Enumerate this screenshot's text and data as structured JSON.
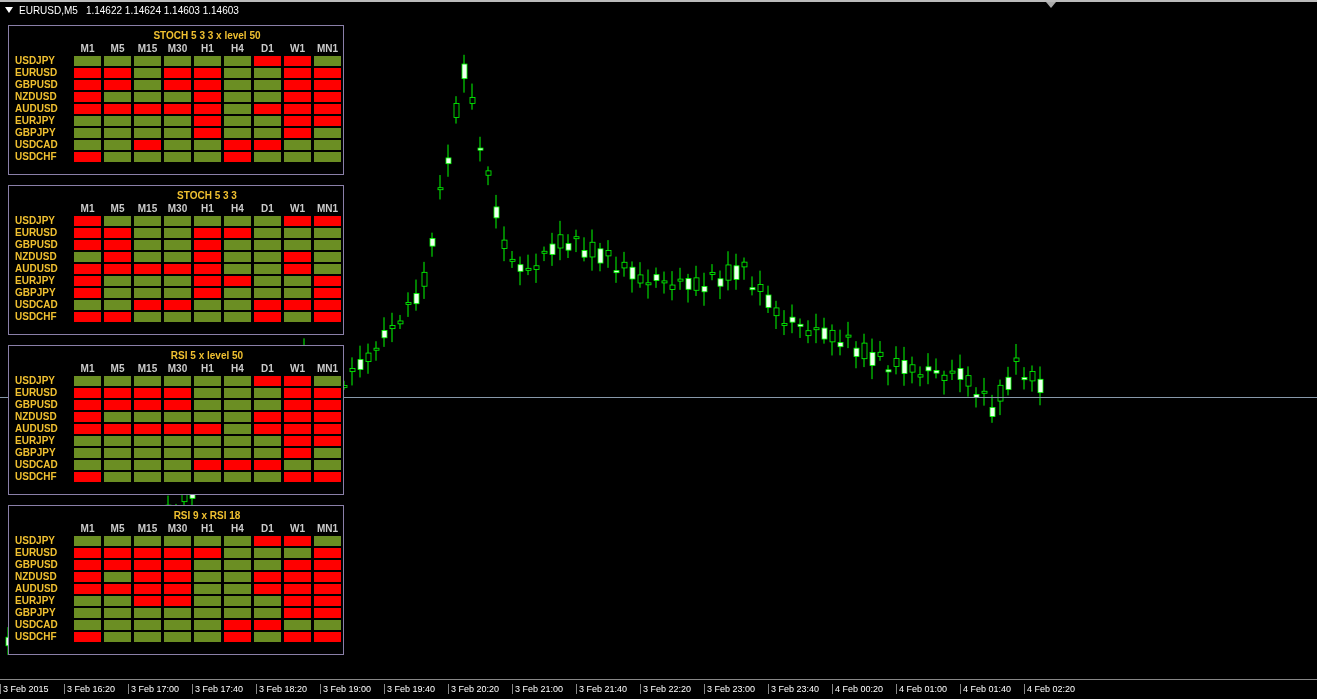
{
  "chart_header": {
    "symbol": "EURUSD,M5",
    "prices": "1.14622 1.14624 1.14603 1.14603"
  },
  "panels": [
    {
      "title": "STOCH 5 3 3 x level 50",
      "columns": [
        "M1",
        "M5",
        "M15",
        "M30",
        "H1",
        "H4",
        "D1",
        "W1",
        "MN1"
      ],
      "rows": [
        {
          "pair": "USDJPY",
          "cells": [
            {
              "color": "#6b8e23"
            },
            {
              "color": "#6b8e23"
            },
            {
              "color": "#6b8e23"
            },
            {
              "color": "#6b8e23"
            },
            {
              "color": "#6b8e23"
            },
            {
              "color": "#6b8e23"
            },
            {
              "color": "#ff0000"
            },
            {
              "color": "#ff0000"
            },
            {
              "color": "#6b8e23"
            }
          ]
        },
        {
          "pair": "EURUSD",
          "cells": [
            {
              "color": "#ff0000"
            },
            {
              "color": "#ff0000"
            },
            {
              "color": "#6b8e23"
            },
            {
              "color": "#ff0000"
            },
            {
              "color": "#ff0000"
            },
            {
              "color": "#6b8e23"
            },
            {
              "color": "#6b8e23"
            },
            {
              "color": "#ff0000"
            },
            {
              "color": "#ff0000"
            }
          ]
        },
        {
          "pair": "GBPUSD",
          "cells": [
            {
              "color": "#ff0000"
            },
            {
              "color": "#ff0000"
            },
            {
              "color": "#6b8e23"
            },
            {
              "color": "#ff0000"
            },
            {
              "color": "#ff0000"
            },
            {
              "color": "#6b8e23"
            },
            {
              "color": "#6b8e23"
            },
            {
              "color": "#ff0000"
            },
            {
              "color": "#ff0000"
            }
          ]
        },
        {
          "pair": "NZDUSD",
          "cells": [
            {
              "color": "#ff0000"
            },
            {
              "color": "#6b8e23"
            },
            {
              "color": "#6b8e23"
            },
            {
              "color": "#6b8e23"
            },
            {
              "color": "#ff0000"
            },
            {
              "color": "#6b8e23"
            },
            {
              "color": "#6b8e23"
            },
            {
              "color": "#ff0000"
            },
            {
              "color": "#ff0000"
            }
          ]
        },
        {
          "pair": "AUDUSD",
          "cells": [
            {
              "color": "#ff0000"
            },
            {
              "color": "#ff0000"
            },
            {
              "color": "#ff0000"
            },
            {
              "color": "#ff0000"
            },
            {
              "color": "#ff0000"
            },
            {
              "color": "#6b8e23"
            },
            {
              "color": "#ff0000"
            },
            {
              "color": "#ff0000"
            },
            {
              "color": "#ff0000"
            }
          ]
        },
        {
          "pair": "EURJPY",
          "cells": [
            {
              "color": "#6b8e23"
            },
            {
              "color": "#6b8e23"
            },
            {
              "color": "#6b8e23"
            },
            {
              "color": "#6b8e23"
            },
            {
              "color": "#ff0000"
            },
            {
              "color": "#6b8e23"
            },
            {
              "color": "#6b8e23"
            },
            {
              "color": "#ff0000"
            },
            {
              "color": "#ff0000"
            }
          ]
        },
        {
          "pair": "GBPJPY",
          "cells": [
            {
              "color": "#6b8e23"
            },
            {
              "color": "#6b8e23"
            },
            {
              "color": "#6b8e23"
            },
            {
              "color": "#6b8e23"
            },
            {
              "color": "#ff0000"
            },
            {
              "color": "#6b8e23"
            },
            {
              "color": "#6b8e23"
            },
            {
              "color": "#ff0000"
            },
            {
              "color": "#6b8e23"
            }
          ]
        },
        {
          "pair": "USDCAD",
          "cells": [
            {
              "color": "#6b8e23"
            },
            {
              "color": "#6b8e23"
            },
            {
              "color": "#ff0000"
            },
            {
              "color": "#6b8e23"
            },
            {
              "color": "#6b8e23"
            },
            {
              "color": "#ff0000"
            },
            {
              "color": "#ff0000"
            },
            {
              "color": "#6b8e23"
            },
            {
              "color": "#6b8e23"
            }
          ]
        },
        {
          "pair": "USDCHF",
          "cells": [
            {
              "color": "#ff0000"
            },
            {
              "color": "#6b8e23"
            },
            {
              "color": "#6b8e23"
            },
            {
              "color": "#6b8e23"
            },
            {
              "color": "#6b8e23"
            },
            {
              "color": "#ff0000"
            },
            {
              "color": "#6b8e23"
            },
            {
              "color": "#6b8e23"
            },
            {
              "color": "#6b8e23"
            }
          ]
        }
      ]
    },
    {
      "title": "STOCH 5 3 3",
      "columns": [
        "M1",
        "M5",
        "M15",
        "M30",
        "H1",
        "H4",
        "D1",
        "W1",
        "MN1"
      ],
      "rows": [
        {
          "pair": "USDJPY",
          "cells": [
            {
              "color": "#ff0000"
            },
            {
              "color": "#6b8e23"
            },
            {
              "color": "#6b8e23"
            },
            {
              "color": "#6b8e23"
            },
            {
              "color": "#6b8e23"
            },
            {
              "color": "#6b8e23"
            },
            {
              "color": "#6b8e23"
            },
            {
              "color": "#ff0000"
            },
            {
              "color": "#ff0000"
            }
          ]
        },
        {
          "pair": "EURUSD",
          "cells": [
            {
              "color": "#ff0000"
            },
            {
              "color": "#ff0000"
            },
            {
              "color": "#6b8e23"
            },
            {
              "color": "#6b8e23"
            },
            {
              "color": "#ff0000"
            },
            {
              "color": "#ff0000"
            },
            {
              "color": "#6b8e23"
            },
            {
              "color": "#6b8e23"
            },
            {
              "color": "#6b8e23"
            }
          ]
        },
        {
          "pair": "GBPUSD",
          "cells": [
            {
              "color": "#ff0000"
            },
            {
              "color": "#ff0000"
            },
            {
              "color": "#6b8e23"
            },
            {
              "color": "#6b8e23"
            },
            {
              "color": "#ff0000"
            },
            {
              "color": "#6b8e23"
            },
            {
              "color": "#6b8e23"
            },
            {
              "color": "#6b8e23"
            },
            {
              "color": "#6b8e23"
            }
          ]
        },
        {
          "pair": "NZDUSD",
          "cells": [
            {
              "color": "#6b8e23"
            },
            {
              "color": "#ff0000"
            },
            {
              "color": "#6b8e23"
            },
            {
              "color": "#6b8e23"
            },
            {
              "color": "#ff0000"
            },
            {
              "color": "#6b8e23"
            },
            {
              "color": "#6b8e23"
            },
            {
              "color": "#ff0000"
            },
            {
              "color": "#6b8e23"
            }
          ]
        },
        {
          "pair": "AUDUSD",
          "cells": [
            {
              "color": "#ff0000"
            },
            {
              "color": "#ff0000"
            },
            {
              "color": "#ff0000"
            },
            {
              "color": "#ff0000"
            },
            {
              "color": "#ff0000"
            },
            {
              "color": "#6b8e23"
            },
            {
              "color": "#6b8e23"
            },
            {
              "color": "#ff0000"
            },
            {
              "color": "#6b8e23"
            }
          ]
        },
        {
          "pair": "EURJPY",
          "cells": [
            {
              "color": "#ff0000"
            },
            {
              "color": "#6b8e23"
            },
            {
              "color": "#6b8e23"
            },
            {
              "color": "#6b8e23"
            },
            {
              "color": "#ff0000"
            },
            {
              "color": "#ff0000"
            },
            {
              "color": "#6b8e23"
            },
            {
              "color": "#6b8e23"
            },
            {
              "color": "#ff0000"
            }
          ]
        },
        {
          "pair": "GBPJPY",
          "cells": [
            {
              "color": "#ff0000"
            },
            {
              "color": "#6b8e23"
            },
            {
              "color": "#6b8e23"
            },
            {
              "color": "#6b8e23"
            },
            {
              "color": "#ff0000"
            },
            {
              "color": "#6b8e23"
            },
            {
              "color": "#6b8e23"
            },
            {
              "color": "#6b8e23"
            },
            {
              "color": "#ff0000"
            }
          ]
        },
        {
          "pair": "USDCAD",
          "cells": [
            {
              "color": "#6b8e23"
            },
            {
              "color": "#6b8e23"
            },
            {
              "color": "#ff0000"
            },
            {
              "color": "#ff0000"
            },
            {
              "color": "#6b8e23"
            },
            {
              "color": "#6b8e23"
            },
            {
              "color": "#ff0000"
            },
            {
              "color": "#ff0000"
            },
            {
              "color": "#ff0000"
            }
          ]
        },
        {
          "pair": "USDCHF",
          "cells": [
            {
              "color": "#ff0000"
            },
            {
              "color": "#ff0000"
            },
            {
              "color": "#6b8e23"
            },
            {
              "color": "#6b8e23"
            },
            {
              "color": "#6b8e23"
            },
            {
              "color": "#6b8e23"
            },
            {
              "color": "#ff0000"
            },
            {
              "color": "#6b8e23"
            },
            {
              "color": "#ff0000"
            }
          ]
        }
      ]
    },
    {
      "title": "RSI 5 x level 50",
      "columns": [
        "M1",
        "M5",
        "M15",
        "M30",
        "H1",
        "H4",
        "D1",
        "W1",
        "MN1"
      ],
      "rows": [
        {
          "pair": "USDJPY",
          "cells": [
            {
              "color": "#6b8e23"
            },
            {
              "color": "#6b8e23"
            },
            {
              "color": "#6b8e23"
            },
            {
              "color": "#6b8e23"
            },
            {
              "color": "#6b8e23"
            },
            {
              "color": "#6b8e23"
            },
            {
              "color": "#ff0000"
            },
            {
              "color": "#ff0000"
            },
            {
              "color": "#6b8e23"
            }
          ]
        },
        {
          "pair": "EURUSD",
          "cells": [
            {
              "color": "#ff0000"
            },
            {
              "color": "#ff0000"
            },
            {
              "color": "#ff0000"
            },
            {
              "color": "#ff0000"
            },
            {
              "color": "#6b8e23"
            },
            {
              "color": "#6b8e23"
            },
            {
              "color": "#6b8e23"
            },
            {
              "color": "#ff0000"
            },
            {
              "color": "#ff0000"
            }
          ]
        },
        {
          "pair": "GBPUSD",
          "cells": [
            {
              "color": "#ff0000"
            },
            {
              "color": "#ff0000"
            },
            {
              "color": "#ff0000"
            },
            {
              "color": "#ff0000"
            },
            {
              "color": "#6b8e23"
            },
            {
              "color": "#6b8e23"
            },
            {
              "color": "#6b8e23"
            },
            {
              "color": "#ff0000"
            },
            {
              "color": "#ff0000"
            }
          ]
        },
        {
          "pair": "NZDUSD",
          "cells": [
            {
              "color": "#ff0000"
            },
            {
              "color": "#6b8e23"
            },
            {
              "color": "#6b8e23"
            },
            {
              "color": "#6b8e23"
            },
            {
              "color": "#6b8e23"
            },
            {
              "color": "#6b8e23"
            },
            {
              "color": "#ff0000"
            },
            {
              "color": "#ff0000"
            },
            {
              "color": "#ff0000"
            }
          ]
        },
        {
          "pair": "AUDUSD",
          "cells": [
            {
              "color": "#ff0000"
            },
            {
              "color": "#ff0000"
            },
            {
              "color": "#ff0000"
            },
            {
              "color": "#ff0000"
            },
            {
              "color": "#ff0000"
            },
            {
              "color": "#6b8e23"
            },
            {
              "color": "#ff0000"
            },
            {
              "color": "#ff0000"
            },
            {
              "color": "#ff0000"
            }
          ]
        },
        {
          "pair": "EURJPY",
          "cells": [
            {
              "color": "#6b8e23"
            },
            {
              "color": "#6b8e23"
            },
            {
              "color": "#6b8e23"
            },
            {
              "color": "#6b8e23"
            },
            {
              "color": "#6b8e23"
            },
            {
              "color": "#6b8e23"
            },
            {
              "color": "#6b8e23"
            },
            {
              "color": "#ff0000"
            },
            {
              "color": "#ff0000"
            }
          ]
        },
        {
          "pair": "GBPJPY",
          "cells": [
            {
              "color": "#6b8e23"
            },
            {
              "color": "#6b8e23"
            },
            {
              "color": "#6b8e23"
            },
            {
              "color": "#6b8e23"
            },
            {
              "color": "#6b8e23"
            },
            {
              "color": "#6b8e23"
            },
            {
              "color": "#6b8e23"
            },
            {
              "color": "#ff0000"
            },
            {
              "color": "#6b8e23"
            }
          ]
        },
        {
          "pair": "USDCAD",
          "cells": [
            {
              "color": "#6b8e23"
            },
            {
              "color": "#6b8e23"
            },
            {
              "color": "#6b8e23"
            },
            {
              "color": "#6b8e23"
            },
            {
              "color": "#ff0000"
            },
            {
              "color": "#ff0000"
            },
            {
              "color": "#ff0000"
            },
            {
              "color": "#6b8e23"
            },
            {
              "color": "#6b8e23"
            }
          ]
        },
        {
          "pair": "USDCHF",
          "cells": [
            {
              "color": "#ff0000"
            },
            {
              "color": "#6b8e23"
            },
            {
              "color": "#6b8e23"
            },
            {
              "color": "#6b8e23"
            },
            {
              "color": "#6b8e23"
            },
            {
              "color": "#6b8e23"
            },
            {
              "color": "#6b8e23"
            },
            {
              "color": "#ff0000"
            },
            {
              "color": "#ff0000"
            }
          ]
        }
      ]
    },
    {
      "title": "RSI 9 x  RSI 18",
      "columns": [
        "M1",
        "M5",
        "M15",
        "M30",
        "H1",
        "H4",
        "D1",
        "W1",
        "MN1"
      ],
      "rows": [
        {
          "pair": "USDJPY",
          "cells": [
            {
              "color": "#6b8e23"
            },
            {
              "color": "#6b8e23"
            },
            {
              "color": "#6b8e23"
            },
            {
              "color": "#6b8e23"
            },
            {
              "color": "#6b8e23"
            },
            {
              "color": "#6b8e23"
            },
            {
              "color": "#ff0000"
            },
            {
              "color": "#ff0000"
            },
            {
              "color": "#6b8e23"
            }
          ]
        },
        {
          "pair": "EURUSD",
          "cells": [
            {
              "color": "#ff0000"
            },
            {
              "color": "#ff0000"
            },
            {
              "color": "#ff0000"
            },
            {
              "color": "#ff0000"
            },
            {
              "color": "#ff0000"
            },
            {
              "color": "#6b8e23"
            },
            {
              "color": "#6b8e23"
            },
            {
              "color": "#6b8e23"
            },
            {
              "color": "#ff0000"
            }
          ]
        },
        {
          "pair": "GBPUSD",
          "cells": [
            {
              "color": "#ff0000"
            },
            {
              "color": "#ff0000"
            },
            {
              "color": "#ff0000"
            },
            {
              "color": "#ff0000"
            },
            {
              "color": "#6b8e23"
            },
            {
              "color": "#6b8e23"
            },
            {
              "color": "#6b8e23"
            },
            {
              "color": "#ff0000"
            },
            {
              "color": "#ff0000"
            }
          ]
        },
        {
          "pair": "NZDUSD",
          "cells": [
            {
              "color": "#ff0000"
            },
            {
              "color": "#6b8e23"
            },
            {
              "color": "#ff0000"
            },
            {
              "color": "#ff0000"
            },
            {
              "color": "#6b8e23"
            },
            {
              "color": "#6b8e23"
            },
            {
              "color": "#ff0000"
            },
            {
              "color": "#ff0000"
            },
            {
              "color": "#ff0000"
            }
          ]
        },
        {
          "pair": "AUDUSD",
          "cells": [
            {
              "color": "#ff0000"
            },
            {
              "color": "#ff0000"
            },
            {
              "color": "#ff0000"
            },
            {
              "color": "#ff0000"
            },
            {
              "color": "#6b8e23"
            },
            {
              "color": "#6b8e23"
            },
            {
              "color": "#ff0000"
            },
            {
              "color": "#ff0000"
            },
            {
              "color": "#ff0000"
            }
          ]
        },
        {
          "pair": "EURJPY",
          "cells": [
            {
              "color": "#6b8e23"
            },
            {
              "color": "#6b8e23"
            },
            {
              "color": "#ff0000"
            },
            {
              "color": "#ff0000"
            },
            {
              "color": "#6b8e23"
            },
            {
              "color": "#6b8e23"
            },
            {
              "color": "#6b8e23"
            },
            {
              "color": "#ff0000"
            },
            {
              "color": "#ff0000"
            }
          ]
        },
        {
          "pair": "GBPJPY",
          "cells": [
            {
              "color": "#6b8e23"
            },
            {
              "color": "#6b8e23"
            },
            {
              "color": "#6b8e23"
            },
            {
              "color": "#6b8e23"
            },
            {
              "color": "#6b8e23"
            },
            {
              "color": "#6b8e23"
            },
            {
              "color": "#6b8e23"
            },
            {
              "color": "#ff0000"
            },
            {
              "color": "#ff0000"
            }
          ]
        },
        {
          "pair": "USDCAD",
          "cells": [
            {
              "color": "#6b8e23"
            },
            {
              "color": "#6b8e23"
            },
            {
              "color": "#6b8e23"
            },
            {
              "color": "#6b8e23"
            },
            {
              "color": "#6b8e23"
            },
            {
              "color": "#ff0000"
            },
            {
              "color": "#ff0000"
            },
            {
              "color": "#6b8e23"
            },
            {
              "color": "#6b8e23"
            }
          ]
        },
        {
          "pair": "USDCHF",
          "cells": [
            {
              "color": "#ff0000"
            },
            {
              "color": "#6b8e23"
            },
            {
              "color": "#6b8e23"
            },
            {
              "color": "#6b8e23"
            },
            {
              "color": "#6b8e23"
            },
            {
              "color": "#ff0000"
            },
            {
              "color": "#6b8e23"
            },
            {
              "color": "#ff0000"
            },
            {
              "color": "#ff0000"
            }
          ]
        }
      ]
    }
  ],
  "time_axis": {
    "labels": [
      "3 Feb 2015",
      "3 Feb 16:20",
      "3 Feb 17:00",
      "3 Feb 17:40",
      "3 Feb 18:20",
      "3 Feb 19:00",
      "3 Feb 19:40",
      "3 Feb 20:20",
      "3 Feb 21:00",
      "3 Feb 21:40",
      "3 Feb 22:20",
      "3 Feb 23:00",
      "3 Feb 23:40",
      "4 Feb 00:20",
      "4 Feb 01:00",
      "4 Feb 01:40",
      "4 Feb 02:20"
    ]
  }
}
